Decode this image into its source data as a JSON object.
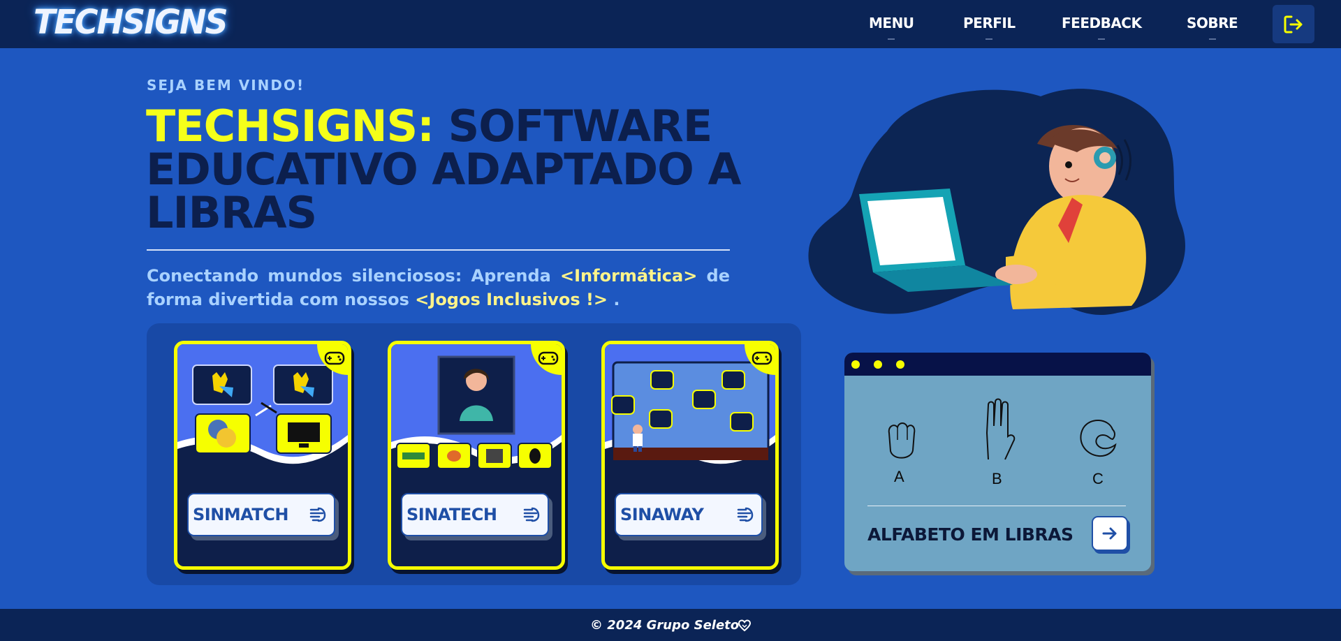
{
  "brand": {
    "logo_text": "TECHSIGNS"
  },
  "nav": {
    "items": [
      {
        "label": "MENU"
      },
      {
        "label": "PERFIL"
      },
      {
        "label": "FEEDBACK"
      },
      {
        "label": "SOBRE"
      }
    ],
    "logout_icon": "logout-icon"
  },
  "hero": {
    "welcome": "SEJA BEM VINDO!",
    "title_highlight": "TECHSIGNS:",
    "title_rest": "SOFTWARE EDUCATIVO ADAPTADO A LIBRAS",
    "tagline_part1": "Conectando mundos silenciosos: Aprenda",
    "tagline_highlight1": "<Informática>",
    "tagline_part2": "de forma divertida com nossos",
    "tagline_highlight2": "<Jogos Inclusivos !>",
    "tagline_end": "."
  },
  "games": [
    {
      "label": "SINMATCH",
      "icon": "gamepad-icon"
    },
    {
      "label": "SINATECH",
      "icon": "gamepad-icon"
    },
    {
      "label": "SINAWAY",
      "icon": "gamepad-icon"
    }
  ],
  "alphabet_card": {
    "letters": [
      "A",
      "B",
      "C"
    ],
    "title": "ALFABETO EM LIBRAS",
    "button_icon": "arrow-right-icon"
  },
  "footer": {
    "copyright": "© 2024 Grupo Seleto",
    "icon": "heart-hand-icon"
  },
  "colors": {
    "background": "#1e57c0",
    "navbar": "#0b2456",
    "accent_yellow": "#f6ff00",
    "heading_dark": "#0c1f4d",
    "light_blue_text": "#a9d2ff"
  }
}
